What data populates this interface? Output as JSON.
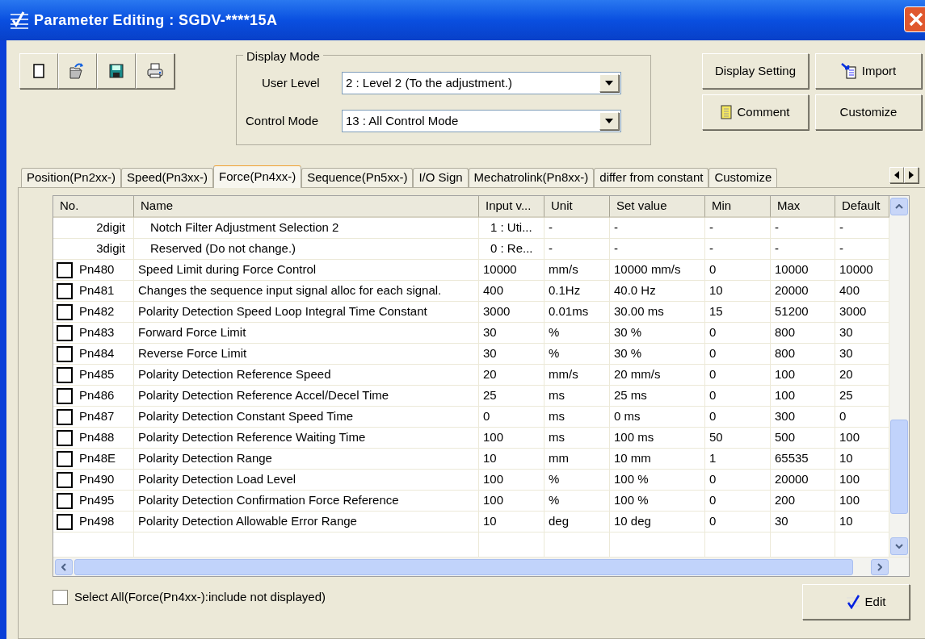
{
  "window": {
    "title": "Parameter Editing : SGDV-****15A"
  },
  "toolbar": [
    {
      "kind": "new"
    },
    {
      "kind": "open"
    },
    {
      "kind": "save"
    },
    {
      "kind": "print"
    }
  ],
  "display_mode": {
    "title": "Display Mode",
    "fields": [
      {
        "label": "User Level",
        "value": "2 : Level 2 (To the adjustment.)"
      },
      {
        "label": "Control Mode",
        "value": "13 : All Control Mode"
      }
    ]
  },
  "buttons": [
    {
      "label": "Display Setting",
      "kind": "plain"
    },
    {
      "label": "Import",
      "kind": "import"
    },
    {
      "label": "Comment",
      "kind": "comment"
    },
    {
      "label": "Customize",
      "kind": "plain"
    }
  ],
  "tabs": [
    {
      "label": "Position(Pn2xx-)",
      "selected": false
    },
    {
      "label": "Speed(Pn3xx-)",
      "selected": false
    },
    {
      "label": "Force(Pn4xx-)",
      "selected": true
    },
    {
      "label": "Sequence(Pn5xx-)",
      "selected": false
    },
    {
      "label": "I/O Sign",
      "selected": false
    },
    {
      "label": "Mechatrolink(Pn8xx-)",
      "selected": false
    },
    {
      "label": "differ from constant",
      "selected": false
    },
    {
      "label": "Customize",
      "selected": false
    }
  ],
  "table": {
    "columns": [
      "No.",
      "Name",
      "Input v...",
      "Unit",
      "Set value",
      "Min",
      "Max",
      "Default"
    ],
    "rows": [
      {
        "kind": "sub",
        "cells": [
          "2digit",
          "Notch Filter Adjustment Selection 2",
          "1 : Uti...",
          "-",
          "-",
          "-",
          "-",
          "-"
        ]
      },
      {
        "kind": "sub",
        "cells": [
          "3digit",
          "Reserved (Do not change.)",
          "0 : Re...",
          "-",
          "-",
          "-",
          "-",
          "-"
        ]
      },
      {
        "kind": "param",
        "checked": false,
        "cells": [
          "Pn480",
          "Speed Limit during Force Control",
          "10000",
          "mm/s",
          "10000 mm/s",
          "0",
          "10000",
          "10000"
        ]
      },
      {
        "kind": "param",
        "checked": false,
        "cells": [
          "Pn481",
          "Changes the sequence input signal alloc for each signal.",
          "400",
          "0.1Hz",
          "40.0 Hz",
          "10",
          "20000",
          "400"
        ]
      },
      {
        "kind": "param",
        "checked": false,
        "cells": [
          "Pn482",
          "Polarity Detection Speed Loop Integral Time Constant",
          "3000",
          "0.01ms",
          "30.00 ms",
          "15",
          "51200",
          "3000"
        ]
      },
      {
        "kind": "param",
        "checked": false,
        "cells": [
          "Pn483",
          "Forward Force Limit",
          "30",
          "%",
          "30 %",
          "0",
          "800",
          "30"
        ]
      },
      {
        "kind": "param",
        "checked": false,
        "cells": [
          "Pn484",
          "Reverse Force Limit",
          "30",
          "%",
          "30 %",
          "0",
          "800",
          "30"
        ]
      },
      {
        "kind": "param",
        "checked": false,
        "cells": [
          "Pn485",
          "Polarity Detection Reference Speed",
          "20",
          "mm/s",
          "20 mm/s",
          "0",
          "100",
          "20"
        ]
      },
      {
        "kind": "param",
        "checked": false,
        "cells": [
          "Pn486",
          "Polarity Detection Reference Accel/Decel Time",
          "25",
          "ms",
          "25 ms",
          "0",
          "100",
          "25"
        ]
      },
      {
        "kind": "param",
        "checked": false,
        "cells": [
          "Pn487",
          "Polarity Detection Constant Speed Time",
          "0",
          "ms",
          "0 ms",
          "0",
          "300",
          "0"
        ]
      },
      {
        "kind": "param",
        "checked": false,
        "cells": [
          "Pn488",
          "Polarity Detection Reference Waiting Time",
          "100",
          "ms",
          "100 ms",
          "50",
          "500",
          "100"
        ]
      },
      {
        "kind": "param",
        "checked": false,
        "cells": [
          "Pn48E",
          "Polarity Detection Range",
          "10",
          "mm",
          "10 mm",
          "1",
          "65535",
          "10"
        ]
      },
      {
        "kind": "param",
        "checked": false,
        "cells": [
          "Pn490",
          "Polarity Detection Load Level",
          "100",
          "%",
          "100 %",
          "0",
          "20000",
          "100"
        ]
      },
      {
        "kind": "param",
        "checked": false,
        "cells": [
          "Pn495",
          "Polarity Detection Confirmation Force Reference",
          "100",
          "%",
          "100 %",
          "0",
          "200",
          "100"
        ]
      },
      {
        "kind": "param",
        "checked": false,
        "cells": [
          "Pn498",
          "Polarity Detection Allowable Error Range",
          "10",
          "deg",
          "10 deg",
          "0",
          "30",
          "10"
        ]
      }
    ]
  },
  "select_all": {
    "label": "Select All(Force(Pn4xx-):include not displayed)",
    "checked": false
  },
  "edit_button": {
    "label": "Edit"
  }
}
